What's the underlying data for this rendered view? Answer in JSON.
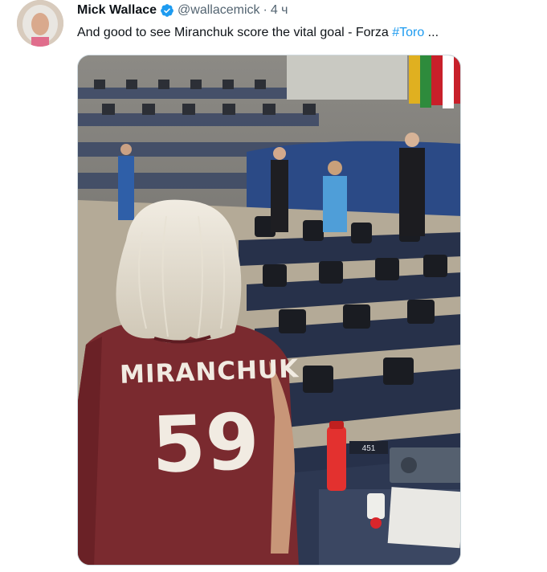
{
  "tweet": {
    "author_name": "Mick Wallace",
    "handle": "@wallacemick",
    "separator": "·",
    "time": "4 ч",
    "text_prefix": "And good to see Miranchuk score the vital goal - Forza ",
    "hashtag": "#Toro",
    "ellipsis": " ..."
  },
  "media": {
    "jersey_name": "MIRANCHUK",
    "jersey_number": "59",
    "desk_label": "451"
  },
  "colors": {
    "link": "#1d9bf0",
    "secondary_text": "#536471",
    "verified_badge": "#1d9bf0",
    "jersey": "#7a2a2f"
  }
}
